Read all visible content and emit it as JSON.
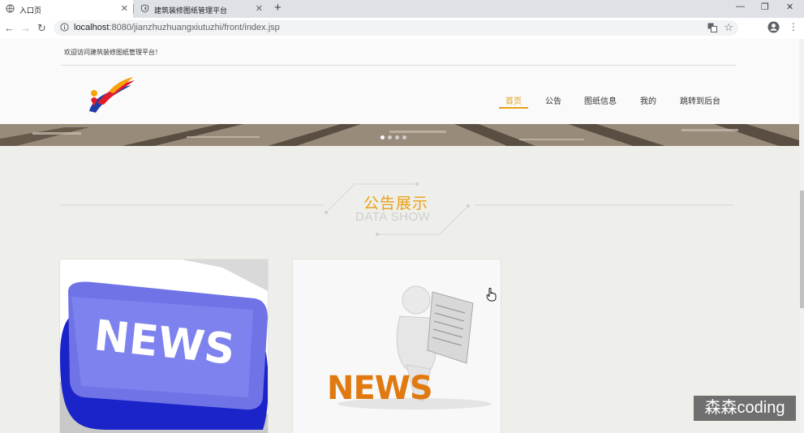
{
  "browser": {
    "tabs": [
      {
        "title": "入口页",
        "icon": "globe-icon",
        "active": true
      },
      {
        "title": "建筑装修图纸管理平台",
        "icon": "shield-icon",
        "active": false
      }
    ],
    "new_tab_label": "+",
    "url_host": "localhost",
    "url_rest": ":8080/jianzhuzhuangxiutuzhi/front/index.jsp"
  },
  "site": {
    "welcome": "欢迎访问建筑装修图纸管理平台！",
    "nav": [
      {
        "label": "首页",
        "active": true
      },
      {
        "label": "公告",
        "active": false
      },
      {
        "label": "图纸信息",
        "active": false
      },
      {
        "label": "我的",
        "active": false
      },
      {
        "label": "跳转到后台",
        "active": false
      }
    ],
    "accent_color": "#e8a317",
    "section": {
      "title_cn": "公告展示",
      "title_en": "DATA SHOW"
    },
    "cards": [
      {
        "image": "news-keyboard-key-image",
        "text": "NEWS"
      },
      {
        "image": "news-reading-figure-image",
        "text": "NEWS"
      }
    ],
    "carousel": {
      "slides": 4,
      "current": 1
    }
  },
  "overlay": {
    "watermark": "森森coding"
  }
}
